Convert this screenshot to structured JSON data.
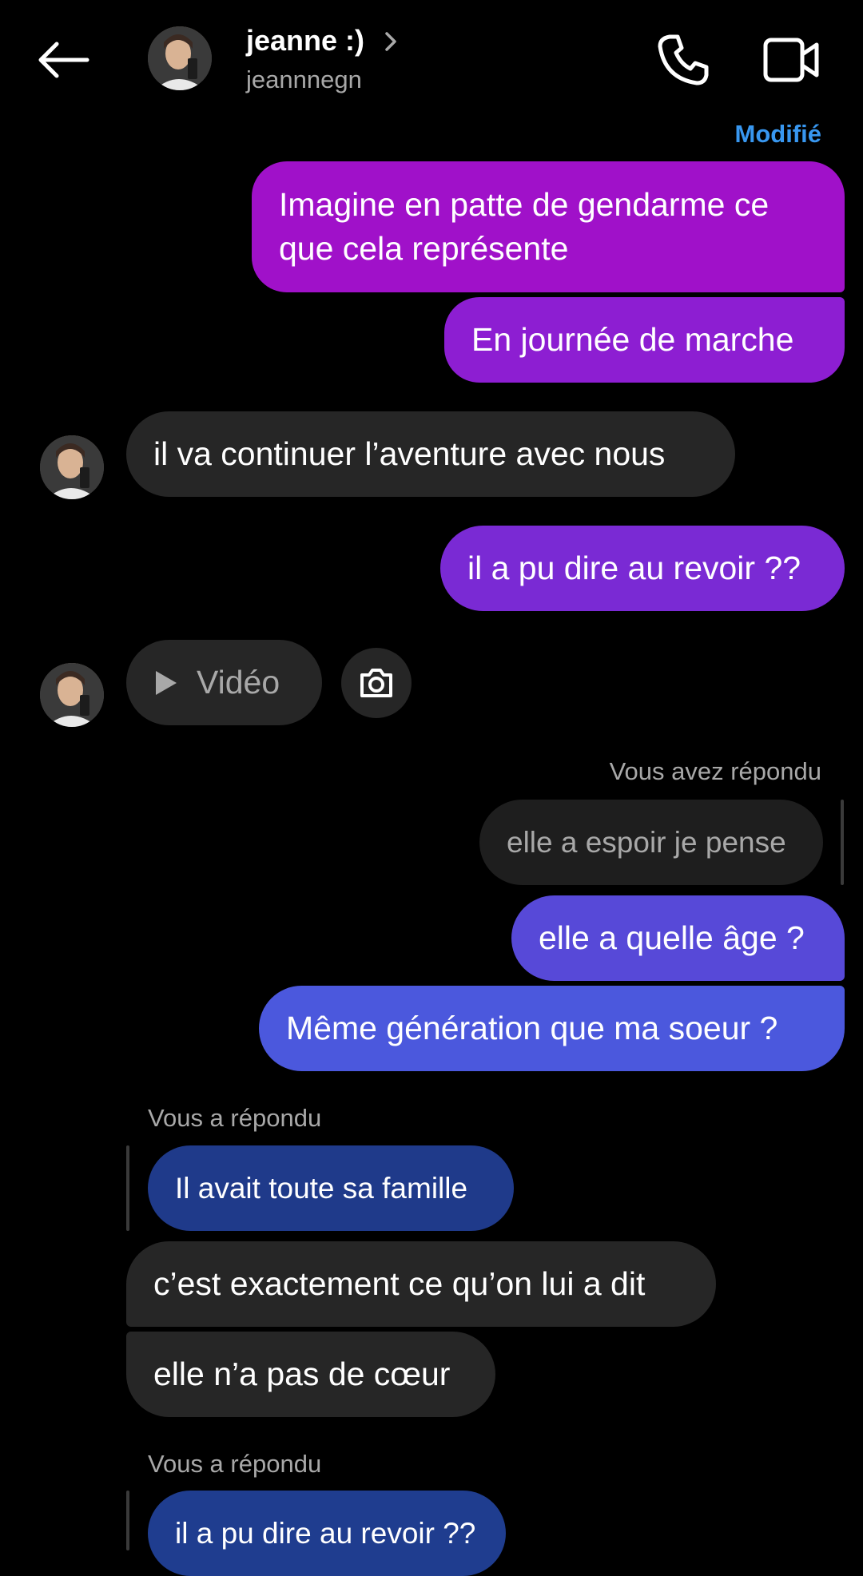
{
  "header": {
    "name": "jeanne :)",
    "username": "jeannnegn"
  },
  "edited_label": "Modifié",
  "messages": {
    "m1": "Imagine en patte de gendarme ce que cela représente",
    "m2": "En journée de marche",
    "m3": "il va continuer l’aventure avec nous",
    "m4": "il a pu dire au revoir ??",
    "video_label": "Vidéo",
    "reply_caption_1": "Vous avez répondu",
    "m5_quoted": "elle a espoir je pense",
    "m6": "elle a quelle âge ?",
    "m7": "Même génération que ma soeur ?",
    "reply_caption_2": "Vous a répondu",
    "m8_quoted": "Il avait toute sa famille",
    "m9": "c’est exactement ce qu’on lui a dit",
    "m10": "elle n’a pas de cœur",
    "reply_caption_3": "Vous a répondu",
    "m11_quoted": "il a pu dire au revoir ??"
  },
  "colors": {
    "background": "#000000",
    "incoming_bubble": "#262626",
    "accent_link": "#3897f0",
    "outgoing_gradient_top": "#a011c9",
    "outgoing_gradient_bottom": "#4b58dd"
  },
  "icons": [
    "back-arrow-icon",
    "chevron-right-icon",
    "phone-icon",
    "video-camera-icon",
    "play-icon",
    "camera-icon"
  ]
}
